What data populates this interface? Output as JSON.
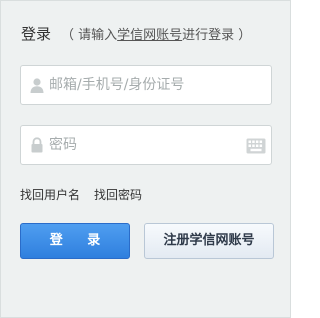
{
  "login": {
    "title": "登录",
    "hint_prefix": "（ 请输入",
    "hint_link": "学信网账号",
    "hint_suffix": "进行登录 ）"
  },
  "form": {
    "account_placeholder": "邮箱/手机号/身份证号",
    "account_value": "",
    "account_icon": "user-icon",
    "password_placeholder": "密码",
    "password_value": "",
    "password_icon": "lock-icon",
    "keyboard_icon": "keyboard-icon"
  },
  "links": {
    "recover_username": "找回用户名",
    "recover_password": "找回密码"
  },
  "buttons": {
    "login_label": "登 录",
    "register_label": "注册学信网账号"
  },
  "colors": {
    "panel_background": "#eef1f1",
    "login_button": "#2f7fde",
    "register_button": "#e8eef5",
    "icon_gray": "#c8cdce"
  }
}
